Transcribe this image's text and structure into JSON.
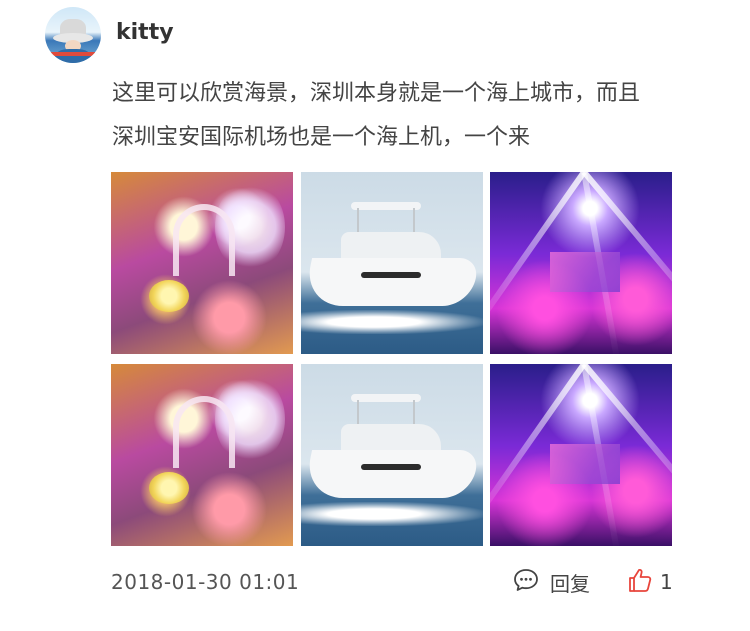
{
  "post": {
    "username": "kitty",
    "text_line1": "这里可以欣赏海景，深圳本身就是一个海上城市，而且",
    "text_line2": "深圳宝安国际机场也是一个海上机，一个来",
    "timestamp": "2018-01-30 01:01"
  },
  "images": [
    {
      "subject": "wedding-hall"
    },
    {
      "subject": "yacht"
    },
    {
      "subject": "concert-stage"
    },
    {
      "subject": "wedding-hall"
    },
    {
      "subject": "yacht"
    },
    {
      "subject": "concert-stage"
    }
  ],
  "actions": {
    "reply_label": "回复",
    "reply_icon": "comment-icon",
    "like_icon": "thumbs-up-icon",
    "like_count": "1",
    "like_color": "#e8453c"
  }
}
